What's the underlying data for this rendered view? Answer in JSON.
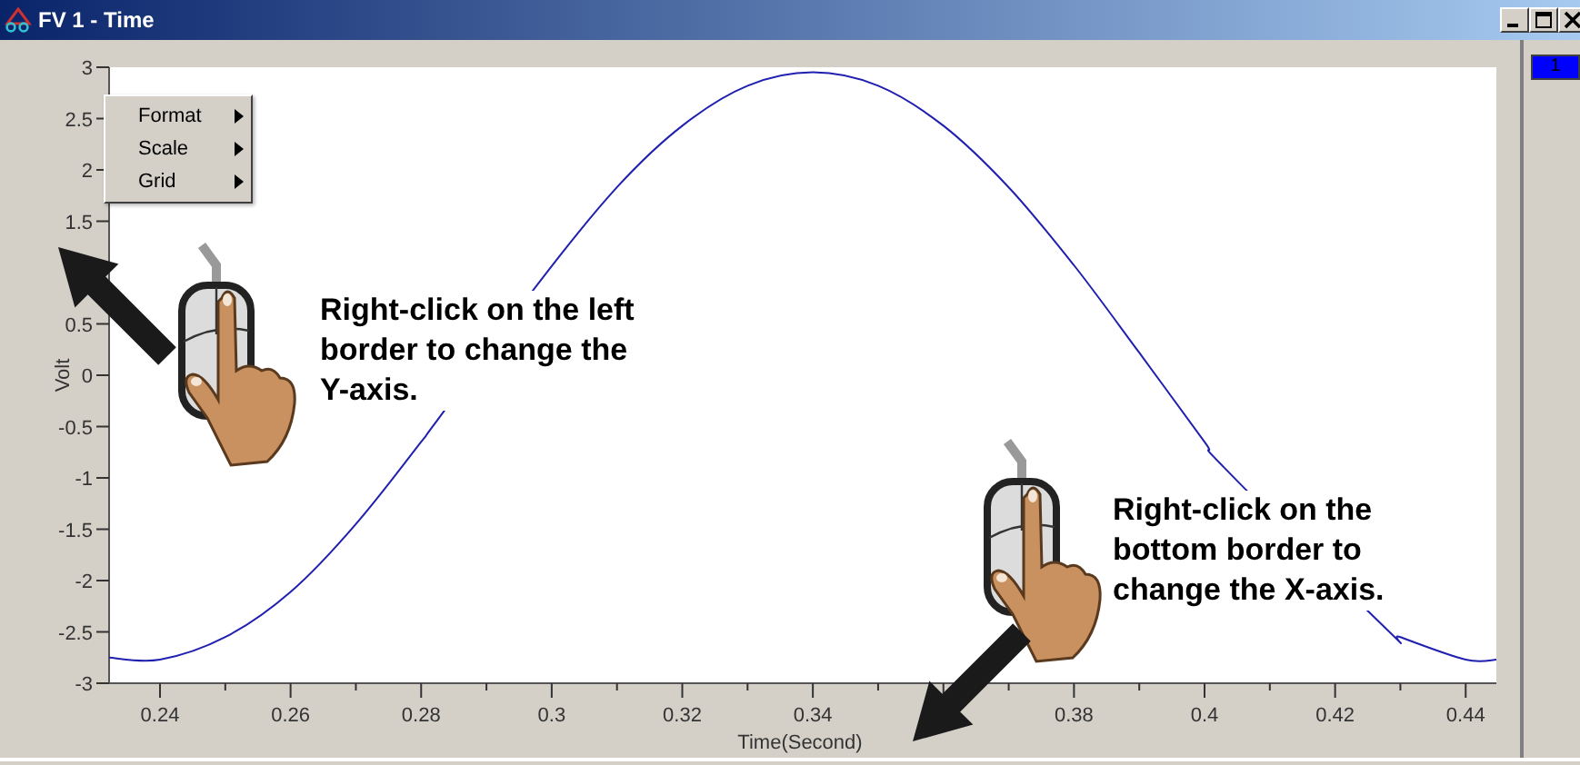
{
  "window": {
    "title": "FV 1 - Time"
  },
  "channel_indicator": {
    "label": "1"
  },
  "context_menu": {
    "items": [
      {
        "label": "Format",
        "has_submenu": true
      },
      {
        "label": "Scale",
        "has_submenu": true
      },
      {
        "label": "Grid",
        "has_submenu": true
      }
    ]
  },
  "chart": {
    "chart_data": {
      "type": "line",
      "xlabel": "Time(Second)",
      "ylabel": "Volt",
      "xlim": [
        0.2322,
        0.4447
      ],
      "ylim": [
        -3,
        3
      ],
      "xticks": [
        0.24,
        0.26,
        0.28,
        0.3,
        0.32,
        0.34,
        0.38,
        0.4,
        0.42,
        0.44
      ],
      "yticks": [
        3,
        2.5,
        2,
        1.5,
        0.5,
        0,
        -0.5,
        -1,
        -1.5,
        -2,
        -2.5,
        -3
      ],
      "x": [
        0.2322,
        0.24,
        0.25,
        0.26,
        0.27,
        0.28,
        0.282,
        0.298,
        0.31,
        0.32,
        0.33,
        0.34,
        0.35,
        0.36,
        0.37,
        0.38,
        0.39,
        0.4,
        0.403,
        0.428,
        0.43,
        0.44,
        0.4447
      ],
      "series": [
        {
          "color": "#2020b0",
          "values": [
            -2.75,
            -2.77,
            -2.55,
            -2.11,
            -1.45,
            -0.65,
            -0.48,
            0.9,
            1.83,
            2.43,
            2.82,
            2.95,
            2.82,
            2.43,
            1.83,
            1.07,
            0.22,
            -0.65,
            -0.9,
            -2.48,
            -2.55,
            -2.77,
            -2.77
          ]
        }
      ]
    }
  },
  "callouts": [
    {
      "lines": [
        "Right-click on the left",
        "border to change the",
        "Y-axis."
      ]
    },
    {
      "lines": [
        "Right-click on the",
        "bottom border to",
        "change the X-axis."
      ]
    }
  ]
}
